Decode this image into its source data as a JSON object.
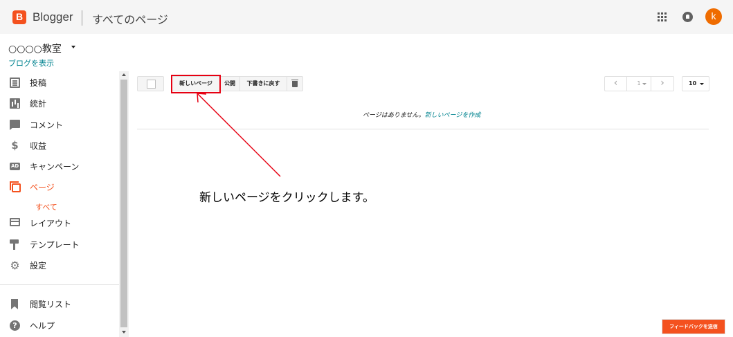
{
  "header": {
    "brand": "Blogger",
    "title": "すべてのページ",
    "avatar_initial": "k",
    "icons": [
      "apps-icon",
      "notifications-icon"
    ]
  },
  "blog": {
    "name": "○○○○教室",
    "view_link": "ブログを表示"
  },
  "sidebar": {
    "items": [
      {
        "label": "投稿",
        "icon": "posts-icon"
      },
      {
        "label": "統計",
        "icon": "stats-icon"
      },
      {
        "label": "コメント",
        "icon": "comment-icon"
      },
      {
        "label": "収益",
        "icon": "dollar-icon"
      },
      {
        "label": "キャンペーン",
        "icon": "ad-icon"
      },
      {
        "label": "ページ",
        "icon": "pages-icon",
        "active": true
      },
      {
        "label": "レイアウト",
        "icon": "layout-icon"
      },
      {
        "label": "テンプレート",
        "icon": "theme-icon"
      },
      {
        "label": "設定",
        "icon": "gear-icon"
      }
    ],
    "sub_item": "すべて",
    "bottom_items": [
      {
        "label": "閲覧リスト",
        "icon": "bookmark-icon"
      },
      {
        "label": "ヘルプ",
        "icon": "help-icon"
      }
    ]
  },
  "toolbar": {
    "new_page": "新しいページ",
    "publish": "公開",
    "revert_draft": "下書きに戻す",
    "page_number": "1",
    "per_page": "10"
  },
  "content": {
    "empty_message": "ページはありません。",
    "create_link": "新しいページを作成"
  },
  "annotation": {
    "text": "新しいページをクリックします。",
    "color": "#e60012"
  },
  "feedback": "フィードバックを送信",
  "colors": {
    "accent": "#f4511e",
    "link": "#00838f",
    "highlight": "#e60012"
  }
}
